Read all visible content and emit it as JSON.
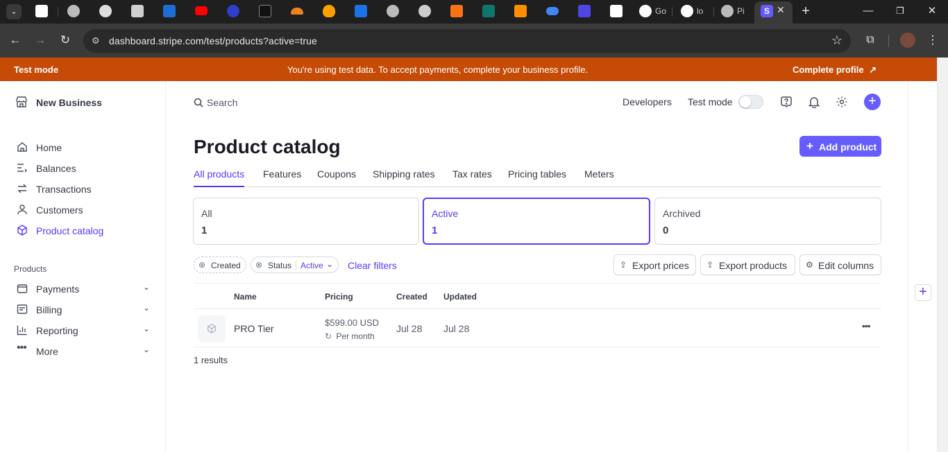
{
  "browser": {
    "url": "dashboard.stripe.com/test/products?active=true",
    "tabs": [
      {
        "label": "Go",
        "icon": "google-icon"
      },
      {
        "label": "lo",
        "icon": "triangle-icon"
      },
      {
        "label": "Pi",
        "icon": "globe-icon"
      }
    ]
  },
  "banner": {
    "mode": "Test mode",
    "message": "You're using test data. To accept payments, complete your business profile.",
    "cta": "Complete profile"
  },
  "sidebar": {
    "business": "New Business",
    "items": [
      {
        "label": "Home",
        "icon": "home-icon"
      },
      {
        "label": "Balances",
        "icon": "balances-icon"
      },
      {
        "label": "Transactions",
        "icon": "transactions-icon"
      },
      {
        "label": "Customers",
        "icon": "customers-icon"
      },
      {
        "label": "Product catalog",
        "icon": "product-catalog-icon",
        "active": true
      }
    ],
    "section_label": "Products",
    "section_items": [
      {
        "label": "Payments",
        "icon": "payments-icon"
      },
      {
        "label": "Billing",
        "icon": "billing-icon"
      },
      {
        "label": "Reporting",
        "icon": "reporting-icon"
      },
      {
        "label": "More",
        "icon": "more-icon"
      }
    ]
  },
  "topbar": {
    "search_placeholder": "Search",
    "developers": "Developers",
    "test_mode": "Test mode"
  },
  "page": {
    "title": "Product catalog",
    "add_button": "Add product",
    "tabs": [
      "All products",
      "Features",
      "Coupons",
      "Shipping rates",
      "Tax rates",
      "Pricing tables",
      "Meters"
    ],
    "cards": [
      {
        "title": "All",
        "count": "1"
      },
      {
        "title": "Active",
        "count": "1"
      },
      {
        "title": "Archived",
        "count": "0"
      }
    ],
    "filters": {
      "created": "Created",
      "status": "Status",
      "status_value": "Active",
      "clear": "Clear filters"
    },
    "actions": {
      "export_prices": "Export prices",
      "export_products": "Export products",
      "edit_columns": "Edit columns"
    },
    "table": {
      "headers": [
        "Name",
        "Pricing",
        "Created",
        "Updated"
      ],
      "rows": [
        {
          "name": "PRO Tier",
          "price": "$599.00 USD",
          "interval": "Per month",
          "created": "Jul 28",
          "updated": "Jul 28"
        }
      ]
    },
    "results": "1 results"
  },
  "colors": {
    "accent": "#533afd",
    "banner": "#c64b06"
  }
}
